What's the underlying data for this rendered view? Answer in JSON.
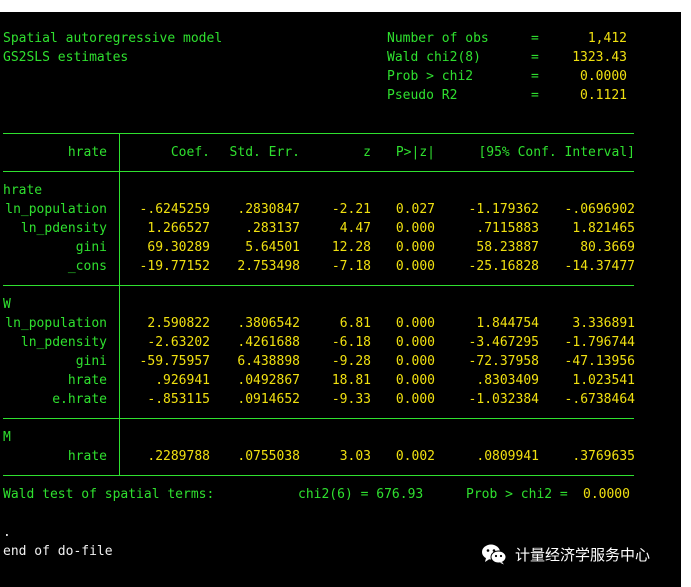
{
  "header": {
    "model_line1": "Spatial autoregressive model",
    "model_line2": "GS2SLS estimates",
    "stats": [
      {
        "label": "Number of obs",
        "eq": "=",
        "value": "1,412"
      },
      {
        "label": "Wald chi2(8)",
        "eq": "=",
        "value": "1323.43"
      },
      {
        "label": "Prob > chi2",
        "eq": "=",
        "value": "0.0000"
      },
      {
        "label": "Pseudo R2",
        "eq": "=",
        "value": "0.1121"
      }
    ]
  },
  "table": {
    "depvar": "hrate",
    "columns": [
      "Coef.",
      "Std. Err.",
      "z",
      "P>|z|",
      "[95% Conf. Interval]"
    ],
    "blocks": [
      {
        "title": "hrate",
        "rows": [
          {
            "name": "ln_population",
            "coef": "-.6245259",
            "se": ".2830847",
            "z": "-2.21",
            "p": "0.027",
            "lo": "-1.179362",
            "hi": "-.0696902"
          },
          {
            "name": "ln_pdensity",
            "coef": "1.266527",
            "se": ".283137",
            "z": "4.47",
            "p": "0.000",
            "lo": ".7115883",
            "hi": "1.821465"
          },
          {
            "name": "gini",
            "coef": "69.30289",
            "se": "5.64501",
            "z": "12.28",
            "p": "0.000",
            "lo": "58.23887",
            "hi": "80.3669"
          },
          {
            "name": "_cons",
            "coef": "-19.77152",
            "se": "2.753498",
            "z": "-7.18",
            "p": "0.000",
            "lo": "-25.16828",
            "hi": "-14.37477"
          }
        ]
      },
      {
        "title": "W",
        "rows": [
          {
            "name": "ln_population",
            "coef": "2.590822",
            "se": ".3806542",
            "z": "6.81",
            "p": "0.000",
            "lo": "1.844754",
            "hi": "3.336891"
          },
          {
            "name": "ln_pdensity",
            "coef": "-2.63202",
            "se": ".4261688",
            "z": "-6.18",
            "p": "0.000",
            "lo": "-3.467295",
            "hi": "-1.796744"
          },
          {
            "name": "gini",
            "coef": "-59.75957",
            "se": "6.438898",
            "z": "-9.28",
            "p": "0.000",
            "lo": "-72.37958",
            "hi": "-47.13956"
          },
          {
            "name": "hrate",
            "coef": ".926941",
            "se": ".0492867",
            "z": "18.81",
            "p": "0.000",
            "lo": ".8303409",
            "hi": "1.023541"
          },
          {
            "name": "e.hrate",
            "coef": "-.853115",
            "se": ".0914652",
            "z": "-9.33",
            "p": "0.000",
            "lo": "-1.032384",
            "hi": "-.6738464"
          }
        ]
      },
      {
        "title": "M",
        "rows": [
          {
            "name": "hrate",
            "coef": ".2289788",
            "se": ".0755038",
            "z": "3.03",
            "p": "0.002",
            "lo": ".0809941",
            "hi": ".3769635"
          }
        ]
      }
    ]
  },
  "footer": {
    "wald_label": "Wald test of spatial terms:",
    "wald_chi2": "chi2(6) = 676.93",
    "wald_prob_label": "Prob > chi2 =",
    "wald_prob_value": "0.0000",
    "dot": ".",
    "end_line": "end of do-file"
  },
  "watermark": {
    "icon": "wechat-icon",
    "text": "计量经济学服务中心"
  },
  "colors": {
    "background": "#000000",
    "text_green": "#2fe02f",
    "text_yellow": "#f0e010",
    "text_white": "#f2f2f2"
  }
}
